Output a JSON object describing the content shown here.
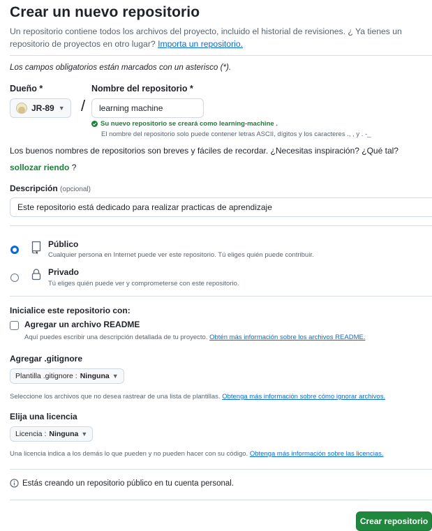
{
  "header": {
    "title": "Crear un nuevo repositorio",
    "subtitle_text": "Un repositorio contiene todos los archivos del proyecto, incluido el historial de revisiones. ¿ Ya tienes un",
    "subtitle_text_2": "repositorio de proyectos en otro lugar?",
    "import_link": "Importa un repositorio."
  },
  "required_note": "Los campos obligatorios están marcados con un asterisco (*).",
  "owner": {
    "label": "Dueño *",
    "value": "JR-89",
    "avatar_icon": "avatar-icon"
  },
  "repo_name": {
    "label": "Nombre del repositorio *",
    "value": "learning machine",
    "status_text": "Su nuevo repositorio se creará como learning-machine .",
    "help_text": "El nombre del repositorio solo puede contener letras ASCII, dígitos y los caracteres   ., , y . -_"
  },
  "separator": "/",
  "inspiration": {
    "text": "Los buenos nombres de repositorios son breves y fáciles de recordar. ¿Necesitas inspiración? ¿Qué tal?",
    "suggestion": "sollozar riendo",
    "question": "?"
  },
  "description": {
    "label": "Descripción",
    "optional": "(opcional)",
    "value": "Este repositorio está dedicado para realizar practicas de aprendizaje"
  },
  "visibility": {
    "public": {
      "label": "Público",
      "desc": "Cualquier persona en Internet puede ver este repositorio. Tú eliges quién puede contribuir.",
      "selected": true
    },
    "private": {
      "label": "Privado",
      "desc": "Tú eliges quién puede ver y comprometerse con este repositorio.",
      "selected": false
    }
  },
  "init": {
    "title": "Inicialice este repositorio con:",
    "readme_label": "Agregar un archivo README",
    "readme_desc": "Aquí puedes escribir una descripción detallada de tu proyecto.",
    "readme_link": "Obtén más información sobre los archivos README."
  },
  "gitignore": {
    "title": "Agregar .gitignore",
    "select_prefix": "Plantilla .gitignore :",
    "select_value": "Ninguna",
    "desc": "Seleccione los archivos que no desea rastrear de una lista de plantillas.",
    "link": "Obtenga más información sobre cómo ignorar archivos."
  },
  "license": {
    "title": "Elija una licencia",
    "select_prefix": "Licencia :",
    "select_value": "Ninguna",
    "desc": "Una licencia indica a los demás lo que pueden y no pueden hacer con su código.",
    "link": "Obtenga más información sobre las licencias."
  },
  "notice": "Estás creando un repositorio público en tu cuenta personal.",
  "create_button": "Crear repositorio",
  "colors": {
    "accent": "#0969da",
    "primary_button": "#1f883d",
    "success": "#1a7f37"
  }
}
